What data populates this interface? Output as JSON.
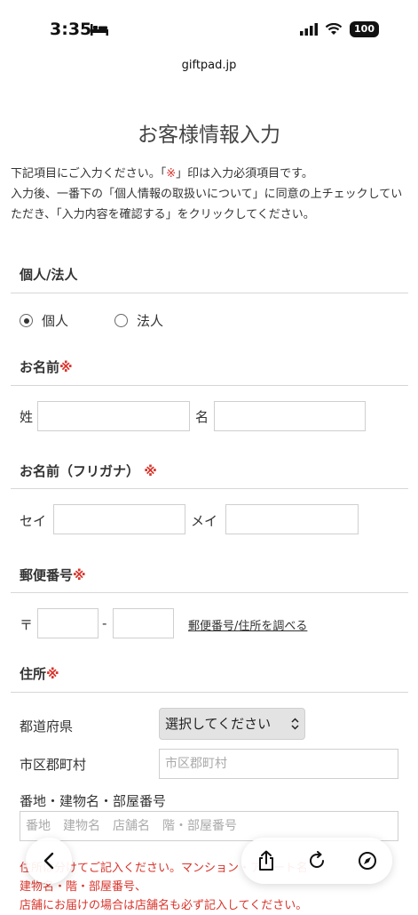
{
  "status_bar": {
    "time": "3:35",
    "battery": "100"
  },
  "browser": {
    "domain": "giftpad.jp"
  },
  "page": {
    "title": "お客様情報入力",
    "intro_line1_a": "下記項目にご入力ください。「",
    "intro_req_mark": "※",
    "intro_line1_b": "」印は入力必須項目です。",
    "intro_line2": "入力後、一番下の「個人情報の取扱いについて」に同意の上チェックしていただき、「入力内容を確認する」をクリックしてください。"
  },
  "form": {
    "type_section": {
      "title": "個人/法人",
      "options": [
        "個人",
        "法人"
      ],
      "selected": "個人"
    },
    "name_section": {
      "title": "お名前",
      "required_mark": "※",
      "last_label": "姓",
      "first_label": "名",
      "last_value": "",
      "first_value": ""
    },
    "kana_section": {
      "title": "お名前（フリガナ）",
      "required_mark": "※",
      "last_label": "セイ",
      "first_label": "メイ"
    },
    "postal_section": {
      "title": "郵便番号",
      "required_mark": "※",
      "prefix": "〒",
      "separator": "-",
      "lookup_link": "郵便番号/住所を調べる"
    },
    "address_section": {
      "title": "住所",
      "required_mark": "※",
      "pref_label": "都道府県",
      "pref_select": "選択してください",
      "city_label": "市区郡町村",
      "city_placeholder": "市区郡町村",
      "street_label": "番地・建物名・部屋番号",
      "street_placeholder": "番地　建物名　店舗名　階・部屋番号"
    },
    "notes": [
      "住所は分けてご記入ください。マンション・アパート名",
      "建物名・階・部屋番号、",
      "店舗にお届けの場合は店舗名も必ず記入してください。"
    ]
  },
  "toolbar": {
    "back": "back-icon",
    "share": "share-icon",
    "reload": "reload-icon",
    "compass": "compass-icon"
  },
  "colors": {
    "required": "#d9342b",
    "divider": "#d7d7d7"
  }
}
